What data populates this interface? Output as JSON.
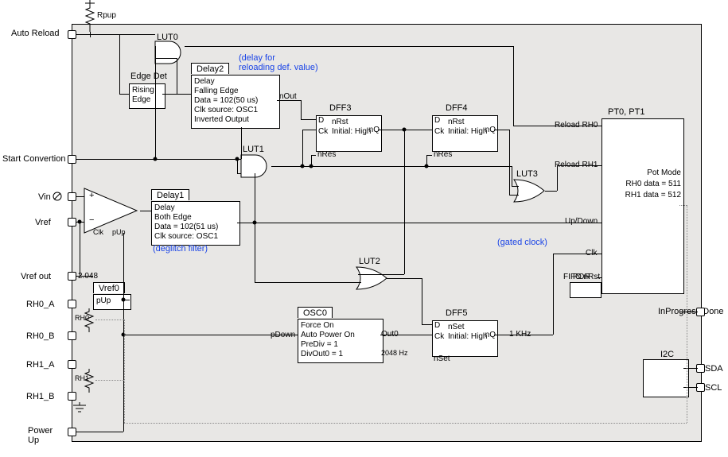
{
  "chart_data": {
    "type": "block-diagram",
    "external_signals_left": [
      "Auto Reload",
      "Start Convertion",
      "Vin",
      "Vref",
      "Vref out",
      "RH0_A",
      "RH0_B",
      "RH1_A",
      "RH1_B",
      "Power Up"
    ],
    "external_signals_right": [
      "InProgress/Done",
      "SDA",
      "SCL"
    ],
    "internal_labels": [
      "Rpup",
      "Edge Det",
      "Rising Edge",
      "LUT0",
      "LUT1",
      "LUT2",
      "LUT3",
      "Delay1",
      "Delay2",
      "DFF3",
      "DFF4",
      "DFF5",
      "Vref0",
      "OSC0",
      "PT0, PT1",
      "POR",
      "I2C",
      "RH0",
      "RH1"
    ],
    "annotations_blue": [
      "(delay for reloading def. value)",
      "(deglitch filter)",
      "(gated clock)"
    ],
    "blocks": {
      "Delay2": {
        "lines": [
          "Delay",
          "Falling Edge",
          "Data = 102(50 us)",
          "Clk source: OSC1",
          "Inverted Output"
        ],
        "out": "nOut"
      },
      "Delay1": {
        "lines": [
          "Delay",
          "Both Edge",
          "Data = 102(51 us)",
          "Clk source: OSC1"
        ]
      },
      "Vref0": {
        "lines": [
          "pUp"
        ],
        "value": "2.048"
      },
      "OSC0": {
        "lines": [
          "Force On",
          "Auto Power On",
          "PreDiv = 1",
          "DivOut0 = 1"
        ],
        "in": "pDown",
        "out": "Out0",
        "out_freq": "2048 Hz"
      },
      "DFF3": {
        "lines": [
          "nRst",
          "Initial: High"
        ],
        "ports": [
          "D",
          "Ck",
          "nRes",
          "nQ"
        ]
      },
      "DFF4": {
        "lines": [
          "nRst",
          "Initial: High"
        ],
        "ports": [
          "D",
          "Ck",
          "nRes",
          "nQ"
        ]
      },
      "DFF5": {
        "lines": [
          "nSet",
          "Initial: High"
        ],
        "ports": [
          "D",
          "Ck",
          "nSet",
          "nQ"
        ],
        "out_freq": "1 KHz"
      },
      "PT": {
        "title": "PT0, PT1",
        "lines": [
          "Pot Mode",
          "RH0 data = 511",
          "RH1 data = 512"
        ],
        "ports": [
          "Reload RH0",
          "Reload RH1",
          "Up/Down",
          "Clk",
          "FIFO nRst"
        ]
      }
    }
  },
  "ext": {
    "autoReload": "Auto Reload",
    "startConv": "Start Convertion",
    "vin": "Vin",
    "vref": "Vref",
    "vrefout": "Vref out",
    "rh0a": "RH0_A",
    "rh0b": "RH0_B",
    "rh1a": "RH1_A",
    "rh1b": "RH1_B",
    "power": "Power",
    "up": "Up",
    "inprog": "InProgress/Done",
    "sda": "SDA",
    "scl": "SCL"
  },
  "rpup": "Rpup",
  "edgeDet": {
    "title": "Edge Det",
    "body": "Rising\nEdge"
  },
  "lut0": "LUT0",
  "lut1": "LUT1",
  "lut2": "LUT2",
  "lut3": "LUT3",
  "delay2": {
    "title": "Delay2",
    "l1": "Delay",
    "l2": "Falling Edge",
    "l3": "Data = 102(50 us)",
    "l4": "Clk source: OSC1",
    "l5": "Inverted Output",
    "out": "nOut"
  },
  "delay1": {
    "title": "Delay1",
    "l1": "Delay",
    "l2": "Both Edge",
    "l3": "Data = 102(51 us)",
    "l4": "Clk source: OSC1"
  },
  "note_delay": "(delay for",
  "note_delay2": "reloading def. value)",
  "note_deglitch": "(deglitch filter)",
  "note_gated": "(gated clock)",
  "dff3": {
    "title": "DFF3",
    "l1": "nRst",
    "l2": "Initial: High",
    "d": "D",
    "ck": "Ck",
    "nq": "nQ",
    "nres": "nRes"
  },
  "dff4": {
    "title": "DFF4",
    "l1": "nRst",
    "l2": "Initial: High",
    "d": "D",
    "ck": "Ck",
    "nq": "nQ",
    "nres": "nRes"
  },
  "dff5": {
    "title": "DFF5",
    "l1": "nSet",
    "l2": "Initial: High",
    "d": "D",
    "ck": "Ck",
    "nq": "nQ",
    "nset": "nSet",
    "freq": "1 KHz"
  },
  "vref0": {
    "title": "Vref0",
    "pup": "pUp",
    "val": "2.048"
  },
  "osc0": {
    "title": "OSC0",
    "l1": "Force On",
    "l2": "Auto Power On",
    "l3": "PreDiv = 1",
    "l4": "DivOut0 = 1",
    "pdown": "pDown",
    "out0": "Out0",
    "freq": "2048 Hz"
  },
  "pt": {
    "title": "PT0, PT1",
    "l1": "Pot Mode",
    "l2": "RH0 data = 511",
    "l3": "RH1 data = 512",
    "rld0": "Reload RH0",
    "rld1": "Reload RH1",
    "ud": "Up/Down",
    "clk": "Clk",
    "fifo": "FIFO nRst"
  },
  "por": "POR",
  "i2c": "I2C",
  "rh0": "RH0",
  "rh1": "RH1",
  "comp": {
    "plus": "+",
    "minus": "−",
    "clk": "Clk",
    "pup": "pUp"
  }
}
